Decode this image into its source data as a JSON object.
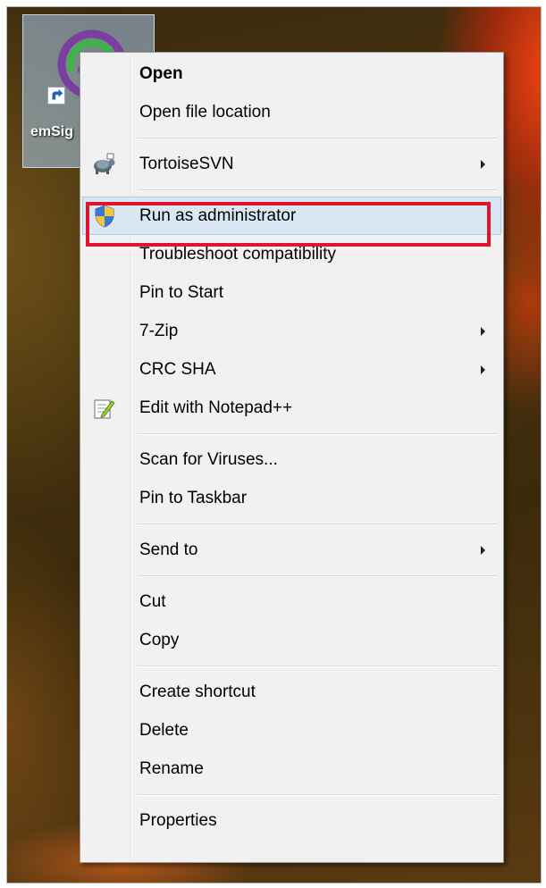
{
  "desktop": {
    "shortcut": {
      "label": "emSig",
      "icon": "app-logo-icon",
      "overlay_icon": "shortcut-arrow-icon",
      "selected": true
    }
  },
  "context_menu": {
    "highlighted_item": "Run as administrator",
    "callout_color": "#e0142d",
    "items": {
      "open": {
        "label": "Open"
      },
      "open_file_location": {
        "label": "Open file location"
      },
      "tortoisesvn": {
        "label": "TortoiseSVN",
        "icon": "tortoisesvn-icon",
        "submenu": true
      },
      "run_as_admin": {
        "label": "Run as administrator",
        "icon": "uac-shield-icon"
      },
      "troubleshoot": {
        "label": "Troubleshoot compatibility"
      },
      "pin_start": {
        "label": "Pin to Start"
      },
      "seven_zip": {
        "label": "7-Zip",
        "submenu": true
      },
      "crc_sha": {
        "label": "CRC SHA",
        "submenu": true
      },
      "notepadpp": {
        "label": "Edit with Notepad++",
        "icon": "notepad-plus-plus-icon"
      },
      "scan_viruses": {
        "label": "Scan for Viruses..."
      },
      "pin_taskbar": {
        "label": "Pin to Taskbar"
      },
      "send_to": {
        "label": "Send to",
        "submenu": true
      },
      "cut": {
        "label": "Cut"
      },
      "copy": {
        "label": "Copy"
      },
      "create_shortcut": {
        "label": "Create shortcut"
      },
      "delete": {
        "label": "Delete"
      },
      "rename": {
        "label": "Rename"
      },
      "properties": {
        "label": "Properties"
      }
    }
  }
}
